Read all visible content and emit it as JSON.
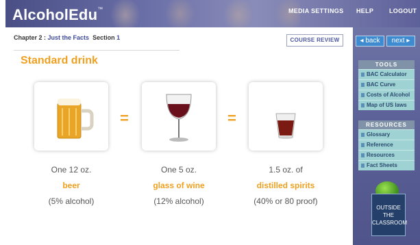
{
  "header": {
    "logo": "AlcoholEdu",
    "logo_tm": "™",
    "nav": [
      "MEDIA SETTINGS",
      "HELP",
      "LOGOUT"
    ]
  },
  "breadcrumb": {
    "chapter_prefix": "Chapter 2 :",
    "chapter_link": "Just the Facts",
    "section_prefix": "Section",
    "section_link": "1"
  },
  "course_review_label": "COURSE REVIEW",
  "pager": {
    "back": "◂ back",
    "next": "next ▸"
  },
  "tools": {
    "header": "TOOLS",
    "items": [
      "BAC Calculator",
      "BAC Curve",
      "Costs of Alcohol",
      "Map of US laws"
    ]
  },
  "resources": {
    "header": "RESOURCES",
    "items": [
      "Glossary",
      "Reference",
      "Resources",
      "Fact Sheets"
    ]
  },
  "main": {
    "title": "Standard drink",
    "equals": "=",
    "drinks": [
      {
        "line1": "One 12 oz.",
        "highlight": "beer",
        "line3": "(5% alcohol)",
        "icon": "beer-mug-icon"
      },
      {
        "line1": "One 5 oz.",
        "highlight": "glass of wine",
        "line3": "(12% alcohol)",
        "icon": "wine-glass-icon"
      },
      {
        "line1": "1.5 oz. of",
        "highlight": "distilled spirits",
        "line3": "(40% or 80 proof)",
        "icon": "shot-glass-icon"
      }
    ]
  },
  "brand": {
    "line1": "OUTSIDE",
    "line2": "THE",
    "line3": "CLASSROOM"
  },
  "colors": {
    "accent": "#f0a020",
    "header": "#5d6199",
    "tool_item": "#9fd3d3"
  }
}
